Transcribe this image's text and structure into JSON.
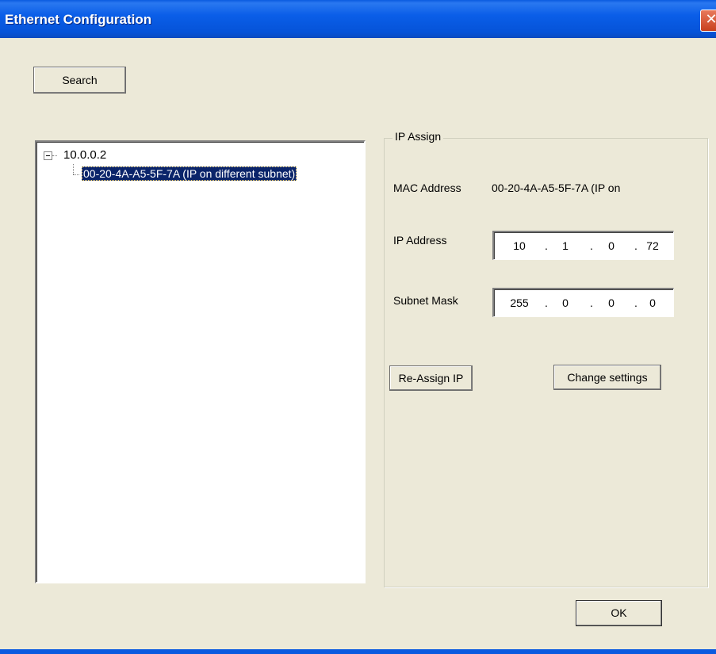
{
  "window": {
    "title": "Ethernet Configuration",
    "close_glyph": "✕"
  },
  "toolbar": {
    "search_label": "Search"
  },
  "tree": {
    "root": {
      "label": "10.0.0.2",
      "expanded": true,
      "children": [
        {
          "label": "00-20-4A-A5-5F-7A (IP on different subnet)",
          "selected": true
        }
      ]
    }
  },
  "ip_assign": {
    "group_title": "IP Assign",
    "mac_label": "MAC Address",
    "mac_value": "00-20-4A-A5-5F-7A (IP on",
    "ip_label": "IP Address",
    "ip_octets": [
      "10",
      "1",
      "0",
      "72"
    ],
    "mask_label": "Subnet Mask",
    "mask_octets": [
      "255",
      "0",
      "0",
      "0"
    ],
    "separator": ".",
    "reassign_label": "Re-Assign IP",
    "change_settings_label": "Change settings"
  },
  "footer": {
    "ok_label": "OK"
  },
  "colors": {
    "titlebar": "#0a5ee8",
    "dialog_bg": "#ece9d8",
    "selection_bg": "#0a246a",
    "selection_fg": "#ffffff"
  },
  "icons": {
    "close": "close-icon",
    "tree_expander": "tree-collapse-icon"
  }
}
